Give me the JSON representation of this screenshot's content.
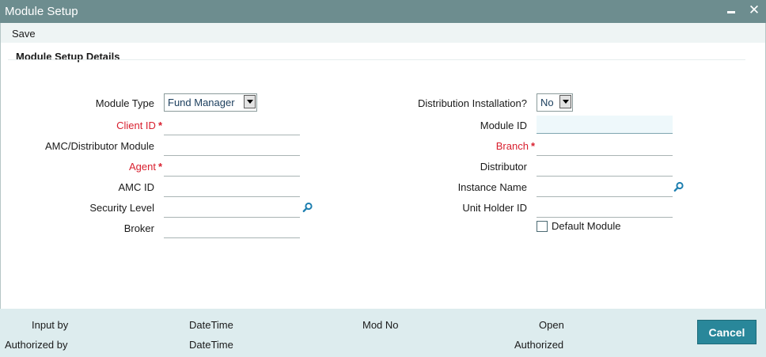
{
  "window": {
    "title": "Module Setup",
    "minimize_icon": "minimize-icon",
    "close_icon": "close-icon",
    "close_glyph": "✕"
  },
  "menu": {
    "save_label": "Save"
  },
  "section": {
    "title": "Module Setup Details"
  },
  "left_fields": {
    "module_type": {
      "label": "Module Type",
      "value": "Fund Manager"
    },
    "client_id": {
      "label": "Client ID",
      "required_mark": "*",
      "value": ""
    },
    "amc_distributor_module": {
      "label": "AMC/Distributor Module",
      "value": ""
    },
    "agent": {
      "label": "Agent",
      "required_mark": "*",
      "value": ""
    },
    "amc_id": {
      "label": "AMC ID",
      "value": ""
    },
    "security_level": {
      "label": "Security Level",
      "value": ""
    },
    "broker": {
      "label": "Broker",
      "value": ""
    }
  },
  "right_fields": {
    "distribution_installation": {
      "label": "Distribution Installation?",
      "value": "No"
    },
    "module_id": {
      "label": "Module ID",
      "value": ""
    },
    "branch": {
      "label": "Branch",
      "required_mark": "*",
      "value": ""
    },
    "distributor": {
      "label": "Distributor",
      "value": ""
    },
    "instance_name": {
      "label": "Instance Name",
      "value": ""
    },
    "unit_holder_id": {
      "label": "Unit Holder ID",
      "value": ""
    },
    "default_module": {
      "label": "Default Module",
      "checked": false
    }
  },
  "footer": {
    "input_by": "Input by",
    "authorized_by": "Authorized by",
    "datetime_1": "DateTime",
    "datetime_2": "DateTime",
    "mod_no": "Mod No",
    "open": "Open",
    "authorized": "Authorized",
    "cancel_label": "Cancel"
  },
  "colors": {
    "titlebar": "#6d8d8f",
    "required": "#d8202f",
    "footer_bg": "#ddecee",
    "cancel_button": "#29879a",
    "lookup_icon": "#1e7fb0"
  }
}
